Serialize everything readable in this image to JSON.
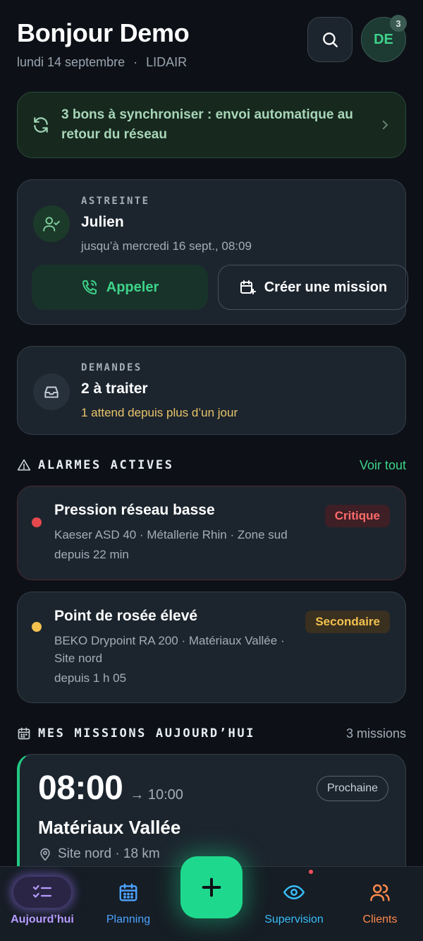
{
  "header": {
    "greeting": "Bonjour Demo",
    "date": "lundi 14 septembre",
    "separator": "·",
    "company": "LIDAIR",
    "avatar_initials": "DE",
    "avatar_badge": "3"
  },
  "sync": {
    "text": "3 bons à synchroniser : envoi automatique au retour du réseau"
  },
  "astreinte": {
    "eyebrow": "ASTREINTE",
    "name": "Julien",
    "until": "jusqu’à mercredi 16 sept., 08:09",
    "call_label": "Appeler",
    "create_label": "Créer une mission"
  },
  "demandes": {
    "eyebrow": "DEMANDES",
    "title": "2 à traiter",
    "warning": "1 attend depuis plus d’un jour"
  },
  "alarms_section": {
    "title": "ALARMES ACTIVES",
    "link": "Voir tout"
  },
  "alarms": [
    {
      "title": "Pression réseau basse",
      "meta": "Kaeser ASD 40 · Métallerie Rhin · Zone sud",
      "since": "depuis 22 min",
      "tag": "Critique",
      "dot_color": "#e5484d",
      "tag_bg": "#3d1f25",
      "tag_color": "#ff6b6b"
    },
    {
      "title": "Point de rosée élevé",
      "meta": "BEKO Drypoint RA 200 · Matériaux Vallée · Site nord",
      "since": "depuis 1 h 05",
      "tag": "Secondaire",
      "dot_color": "#f2c14e",
      "tag_bg": "#3a3020",
      "tag_color": "#f2c14e"
    }
  ],
  "missions_section": {
    "title": "MES MISSIONS AUJOURD’HUI",
    "count": "3 missions"
  },
  "mission": {
    "start": "08:00",
    "end": "→ 10:00",
    "status": "Prochaine",
    "client": "Matériaux Vallée",
    "location": "Site nord · 18 km"
  },
  "nav": {
    "today": "Aujourd’hui",
    "planning": "Planning",
    "supervision": "Supervision",
    "clients": "Clients"
  },
  "colors": {
    "accent": "#1ed98d",
    "today": "#b79cff",
    "planning": "#4da3ff",
    "supervision": "#38bdf8",
    "clients": "#ff8a4c"
  }
}
